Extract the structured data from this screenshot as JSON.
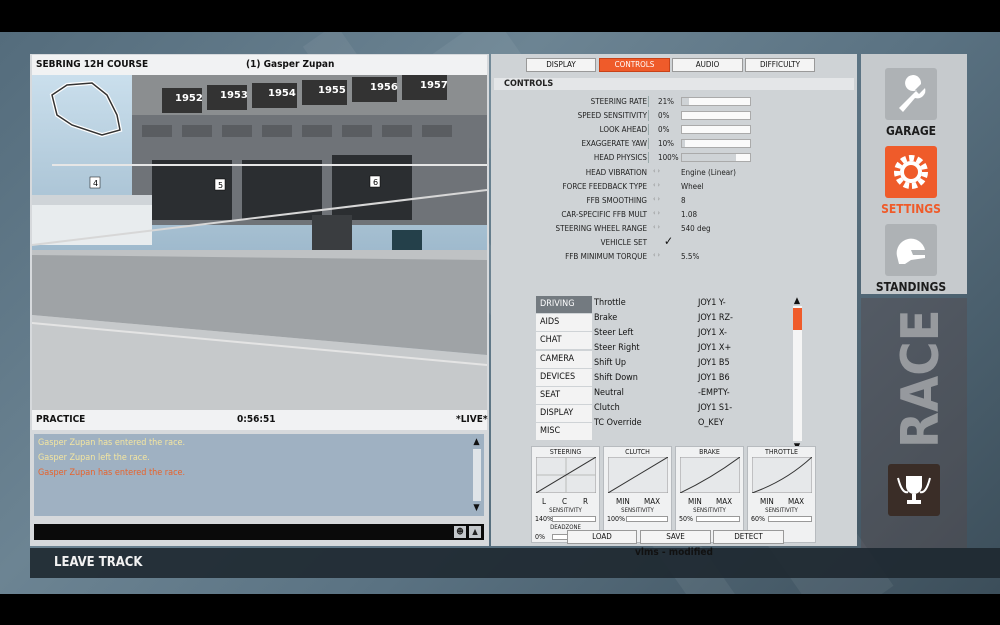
{
  "viewport": {
    "track_name": "SEBRING 12H COURSE",
    "driver_label": "(1) Gasper Zupan",
    "session": "PRACTICE",
    "time": "0:56:51",
    "live_label": "*LIVE*",
    "banners": [
      "1952",
      "1953",
      "1954",
      "1955",
      "1956",
      "1957"
    ],
    "garage_numbers": [
      "4",
      "5",
      "6"
    ]
  },
  "chat": {
    "messages": [
      {
        "text": "Gasper Zupan has entered the race.",
        "color": "#f4e6a0"
      },
      {
        "text": "Gasper Zupan left the race.",
        "color": "#f4e6a0"
      },
      {
        "text": "Gasper Zupan has entered the race.",
        "color": "#e8622a"
      }
    ]
  },
  "bottom": {
    "leave_track": "LEAVE TRACK"
  },
  "tabs": [
    {
      "label": "DISPLAY",
      "active": false
    },
    {
      "label": "CONTROLS",
      "active": true
    },
    {
      "label": "AUDIO",
      "active": false
    },
    {
      "label": "DIFFICULTY",
      "active": false
    }
  ],
  "controls": {
    "section_title": "CONTROLS",
    "sliders": [
      {
        "label": "STEERING RATE",
        "value": "21%",
        "fill": 0.1
      },
      {
        "label": "SPEED SENSITIVITY",
        "value": "0%",
        "fill": 0.0
      },
      {
        "label": "LOOK AHEAD",
        "value": "0%",
        "fill": 0.0
      },
      {
        "label": "EXAGGERATE YAW",
        "value": "10%",
        "fill": 0.05
      },
      {
        "label": "HEAD PHYSICS",
        "value": "100%",
        "fill": 0.8
      }
    ],
    "options": [
      {
        "label": "HEAD VIBRATION",
        "value": "Engine (Linear)"
      },
      {
        "label": "FORCE FEEDBACK TYPE",
        "value": "Wheel"
      },
      {
        "label": "FFB SMOOTHING",
        "value": "8"
      },
      {
        "label": "CAR-SPECIFIC FFB MULT",
        "value": "1.08"
      },
      {
        "label": "STEERING WHEEL RANGE",
        "value": "540 deg"
      },
      {
        "label": "VEHICLE SET",
        "value": "✓"
      },
      {
        "label": "FFB MINIMUM TORQUE",
        "value": "5.5%"
      }
    ]
  },
  "categories": [
    {
      "label": "DRIVING",
      "active": true
    },
    {
      "label": "AIDS",
      "active": false
    },
    {
      "label": "CHAT",
      "active": false
    },
    {
      "label": "CAMERA",
      "active": false
    },
    {
      "label": "DEVICES",
      "active": false
    },
    {
      "label": "SEAT",
      "active": false
    },
    {
      "label": "DISPLAY",
      "active": false
    },
    {
      "label": "MISC",
      "active": false
    }
  ],
  "bindings": [
    {
      "action": "Throttle",
      "key": "JOY1 Y-"
    },
    {
      "action": "Brake",
      "key": "JOY1 RZ-"
    },
    {
      "action": "Steer Left",
      "key": "JOY1 X-"
    },
    {
      "action": "Steer Right",
      "key": "JOY1 X+"
    },
    {
      "action": "Shift Up",
      "key": "JOY1 B5"
    },
    {
      "action": "Shift Down",
      "key": "JOY1 B6"
    },
    {
      "action": "Neutral",
      "key": "-EMPTY-"
    },
    {
      "action": "Clutch",
      "key": "JOY1 S1-"
    },
    {
      "action": "TC Override",
      "key": "O_KEY"
    }
  ],
  "curves": {
    "steering": {
      "title": "STEERING",
      "l": "L",
      "c": "C",
      "r": "R",
      "sens_label": "SENSITIVITY",
      "sens": "140%",
      "dz_label": "DEADZONE",
      "dz": "0%"
    },
    "clutch": {
      "title": "CLUTCH",
      "min": "MIN",
      "max": "MAX",
      "sens_label": "SENSITIVITY",
      "sens": "100%"
    },
    "brake": {
      "title": "BRAKE",
      "min": "MIN",
      "max": "MAX",
      "sens_label": "SENSITIVITY",
      "sens": "50%"
    },
    "throttle": {
      "title": "THROTTLE",
      "min": "MIN",
      "max": "MAX",
      "sens_label": "SENSITIVITY",
      "sens": "60%"
    }
  },
  "profile": {
    "name": "vlms - modified",
    "load": "LOAD",
    "save": "SAVE",
    "detect": "DETECT"
  },
  "nav": {
    "garage": "GARAGE",
    "settings": "SETTINGS",
    "standings": "STANDINGS",
    "race": "RACE",
    "accent": "#ef5b2a"
  }
}
